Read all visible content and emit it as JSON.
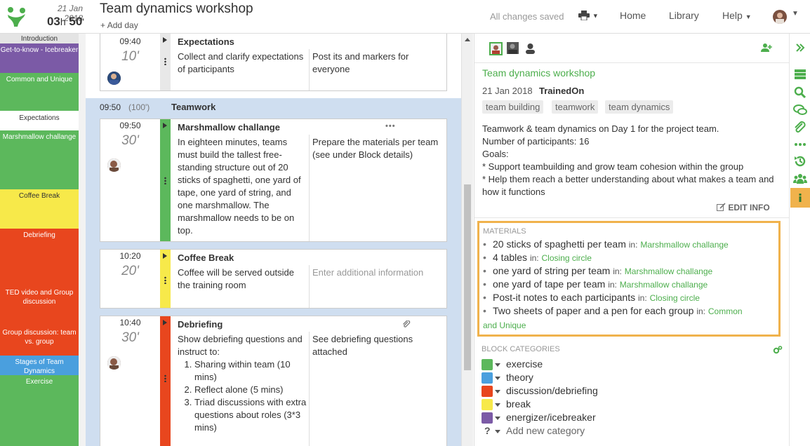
{
  "header": {
    "date": "21 Jan 2018",
    "duration_hours": "03",
    "duration_h_unit": "h",
    "duration_minutes": "50",
    "duration_m_unit": "'",
    "title": "Team dynamics workshop",
    "add_day": "Add day",
    "saved_status": "All changes saved",
    "nav": {
      "home": "Home",
      "library": "Library",
      "help": "Help"
    }
  },
  "timeline": [
    {
      "label": "Introduction",
      "color": "#e4e4e4"
    },
    {
      "label": "Get-to-know - Icebreaker",
      "color": "#7b5aa6"
    },
    {
      "label": "Common and Unique",
      "color": "#5cb85c"
    },
    {
      "label": "Expectations",
      "color": "#ffffff"
    },
    {
      "label": "Marshmallow challange",
      "color": "#5cb85c"
    },
    {
      "label": "Coffee Break",
      "color": "#f7e94a"
    },
    {
      "label": "Debriefing",
      "color": "#e8461e"
    },
    {
      "label": "TED video and Group discussion",
      "color": "#e8461e"
    },
    {
      "label": "Group discussion: team vs. group",
      "color": "#e8461e"
    },
    {
      "label": "Stages of Team Dynamics",
      "color": "#4a9fde"
    },
    {
      "label": "Exercise",
      "color": "#5cb85c"
    }
  ],
  "blocks": {
    "expectations": {
      "time": "09:40",
      "duration": "10'",
      "title": "Expectations",
      "description": "Collect and clarify expectations of participants",
      "notes": "Post its and markers for everyone"
    },
    "section": {
      "time": "09:50",
      "duration": "(100')",
      "title": "Teamwork"
    },
    "marshmallow": {
      "time": "09:50",
      "duration": "30'",
      "title": "Marshmallow challange",
      "description": "In eighteen minutes, teams must build the tallest free-standing structure out of 20 sticks of spaghetti, one yard of tape, one yard of string, and one marshmallow. The marshmallow needs to be on top.",
      "notes": "Prepare the materials per team (see under Block details)"
    },
    "coffee": {
      "time": "10:20",
      "duration": "20'",
      "title": "Coffee Break",
      "description": "Coffee will be served outside the training room",
      "notes_placeholder": "Enter additional information"
    },
    "debriefing": {
      "time": "10:40",
      "duration": "30'",
      "title": "Debriefing",
      "description": "Show debriefing questions and instruct to:",
      "steps": [
        "Sharing within team (10 mins)",
        "Reflect alone (5 mins)",
        "Triad discussions with extra questions about roles (3*3 mins)"
      ],
      "notes": "See debriefing questions attached"
    }
  },
  "info": {
    "title": "Team dynamics workshop",
    "date": "21 Jan 2018",
    "organization": "TrainedOn",
    "tags": [
      "team building",
      "teamwork",
      "team dynamics"
    ],
    "description": [
      "Teamwork & team dynamics on Day 1 for the project team.",
      "Number of participants: 16",
      "Goals:",
      "* Support teambuilding and grow team cohesion within the group",
      "* Help them reach a better understanding about what makes a team and how it functions"
    ],
    "edit_label": "EDIT INFO"
  },
  "materials": {
    "heading": "MATERIALS",
    "in_label": "in:",
    "items": [
      {
        "name": "20 sticks of spaghetti per team",
        "block": "Marshmallow challange"
      },
      {
        "name": "4 tables",
        "block": "Closing circle"
      },
      {
        "name": "one yard of string per team",
        "block": "Marshmallow challange"
      },
      {
        "name": "one yard of tape per team",
        "block": "Marshmallow challange"
      },
      {
        "name": "Post-it notes to each participants",
        "block": "Closing circle"
      },
      {
        "name": "Two sheets of paper and a pen for each group",
        "block": "Common and Unique"
      }
    ]
  },
  "categories": {
    "heading": "BLOCK CATEGORIES",
    "items": [
      {
        "name": "exercise",
        "color": "#5cb85c"
      },
      {
        "name": "theory",
        "color": "#4a9fde"
      },
      {
        "name": "discussion/debriefing",
        "color": "#e8461e"
      },
      {
        "name": "break",
        "color": "#f7e94a"
      },
      {
        "name": "energizer/icebreaker",
        "color": "#7b5aa6"
      }
    ],
    "add_label": "Add new category",
    "add_symbol": "?"
  },
  "colors": {
    "accent": "#4cae4c",
    "highlight": "#f0b24c",
    "section_bg": "#cfdef0"
  }
}
